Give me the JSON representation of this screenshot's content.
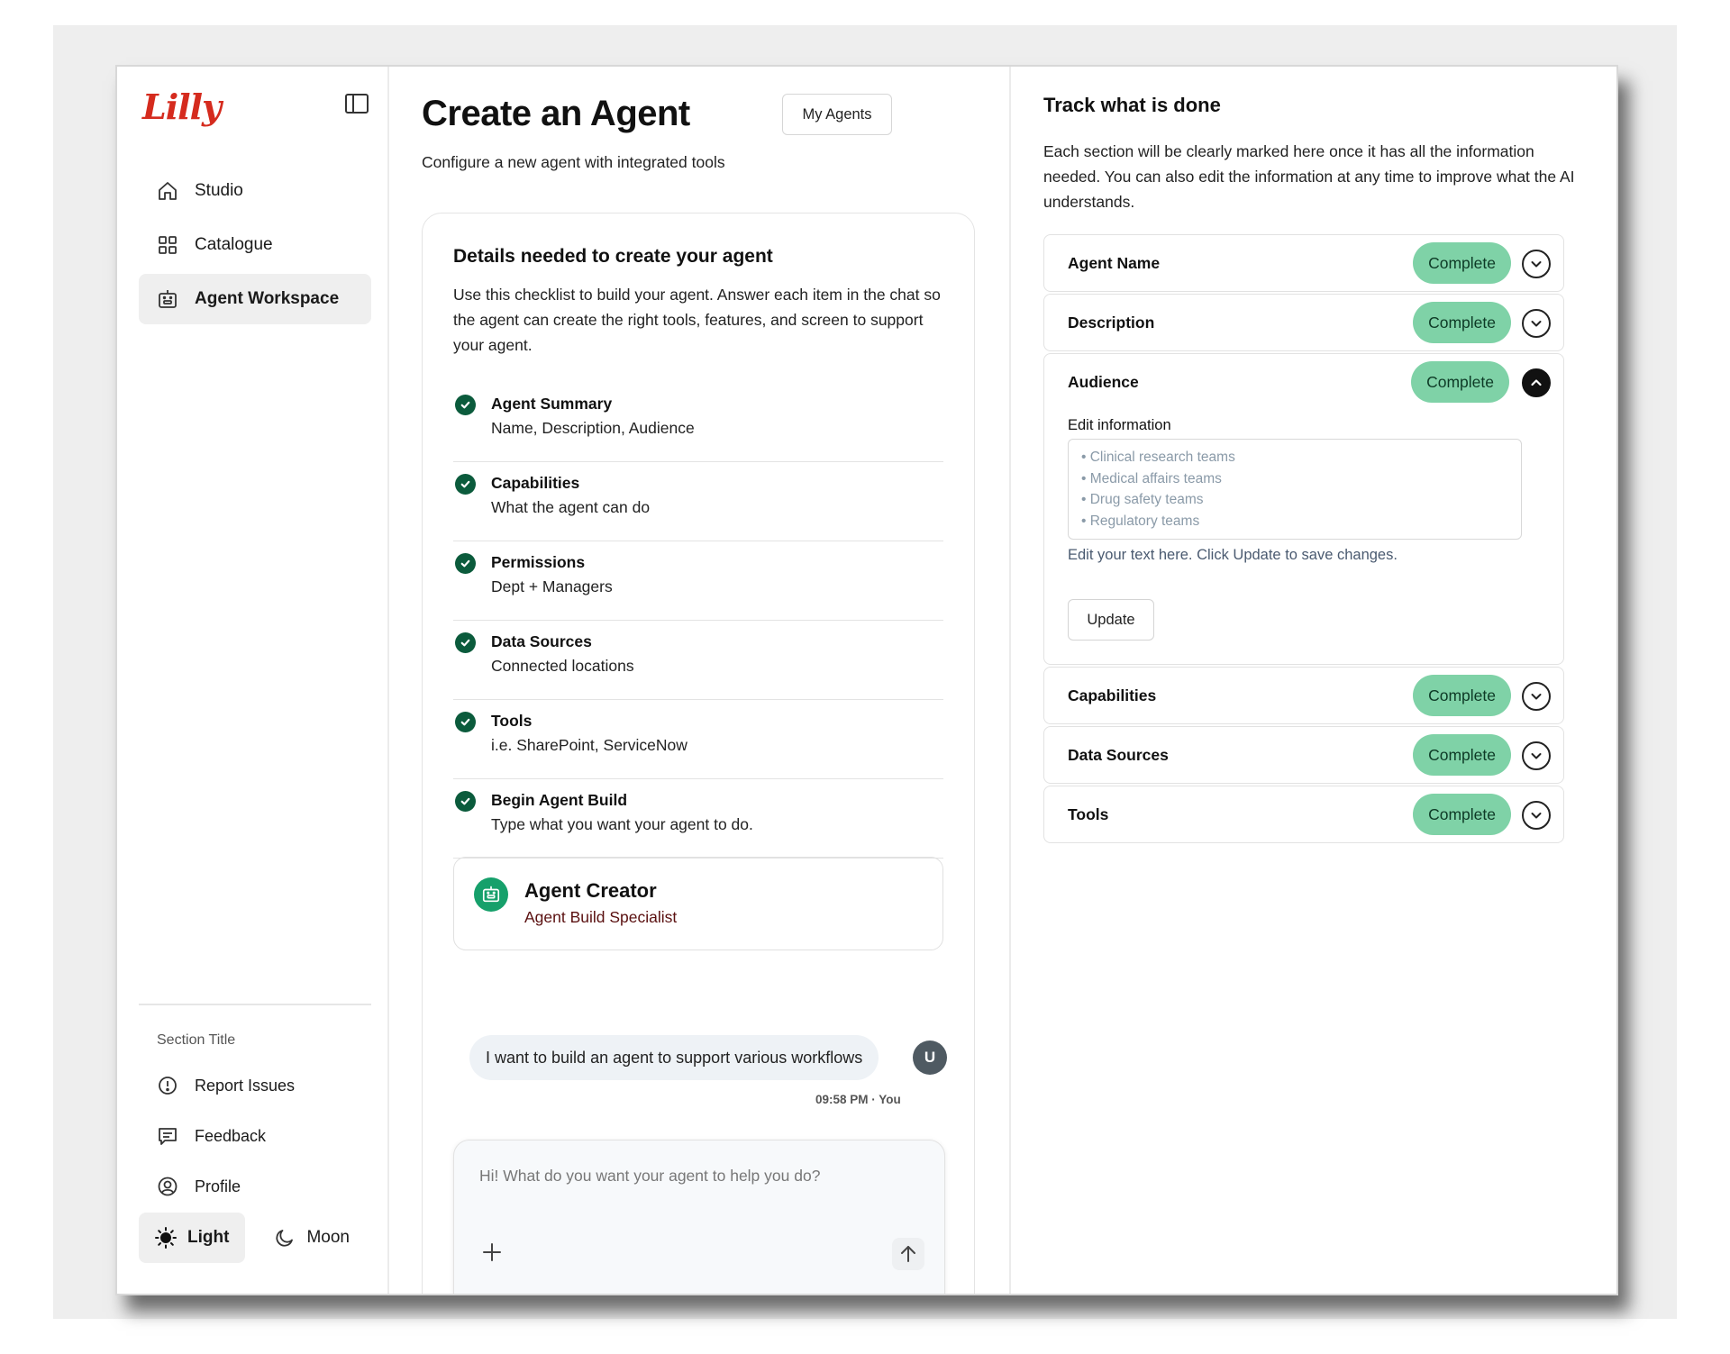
{
  "sidebar": {
    "logo": "Lilly",
    "nav": [
      {
        "label": "Studio",
        "icon": "home-icon"
      },
      {
        "label": "Catalogue",
        "icon": "grid-icon"
      },
      {
        "label": "Agent Workspace",
        "icon": "robot-icon",
        "active": true
      }
    ],
    "section_title": "Section Title",
    "bottom_nav": [
      {
        "label": "Report Issues",
        "icon": "alert-circle-icon"
      },
      {
        "label": "Feedback",
        "icon": "message-square-icon"
      },
      {
        "label": "Profile",
        "icon": "user-circle-icon"
      }
    ],
    "theme": {
      "light_label": "Light",
      "dark_label": "Moon",
      "selected": "Light"
    }
  },
  "main": {
    "title": "Create an Agent",
    "subtitle": "Configure a new agent with integrated tools",
    "my_agents_label": "My Agents",
    "card": {
      "title": "Details needed to create your agent",
      "description": "Use this checklist to build your agent. Answer each item in the chat so the agent can create the right tools, features, and screen to support your agent.",
      "checklist": [
        {
          "title": "Agent Summary",
          "sub": "Name, Description, Audience"
        },
        {
          "title": "Capabilities",
          "sub": "What the agent can do"
        },
        {
          "title": "Permissions",
          "sub": "Dept + Managers"
        },
        {
          "title": "Data Sources",
          "sub": "Connected locations"
        },
        {
          "title": "Tools",
          "sub": "i.e. SharePoint, ServiceNow"
        },
        {
          "title": "Begin Agent Build",
          "sub": "Type what you want your agent to do."
        }
      ],
      "creator": {
        "name": "Agent Creator",
        "role": "Agent Build Specialist"
      },
      "message": {
        "text": "I want to build an agent to support various workflows",
        "avatar": "U",
        "time": "09:58 PM · You"
      },
      "composer": {
        "placeholder": "Hi! What do you want your agent to help you do?"
      }
    }
  },
  "right": {
    "title": "Track what is done",
    "description": "Each section will be clearly marked here once it has all the information needed. You can also edit the information at any time to improve what the AI understands.",
    "sections": [
      {
        "label": "Agent Name",
        "status": "Complete",
        "expanded": false
      },
      {
        "label": "Description",
        "status": "Complete",
        "expanded": false
      },
      {
        "label": "Audience",
        "status": "Complete",
        "expanded": true
      },
      {
        "label": "Capabilities",
        "status": "Complete",
        "expanded": false
      },
      {
        "label": "Data Sources",
        "status": "Complete",
        "expanded": false
      },
      {
        "label": "Tools",
        "status": "Complete",
        "expanded": false
      }
    ],
    "edit": {
      "label": "Edit information",
      "lines": [
        "• Clinical research teams",
        "• Medical affairs teams",
        "• Drug safety teams",
        "• Regulatory teams"
      ],
      "hint": "Edit your text here. Click Update to save changes.",
      "update_label": "Update"
    }
  },
  "colors": {
    "brand_red": "#d52b1e",
    "check_green": "#0b5b3c",
    "complete_pill": "#7fd2a7",
    "creator_green": "#16a06b"
  }
}
